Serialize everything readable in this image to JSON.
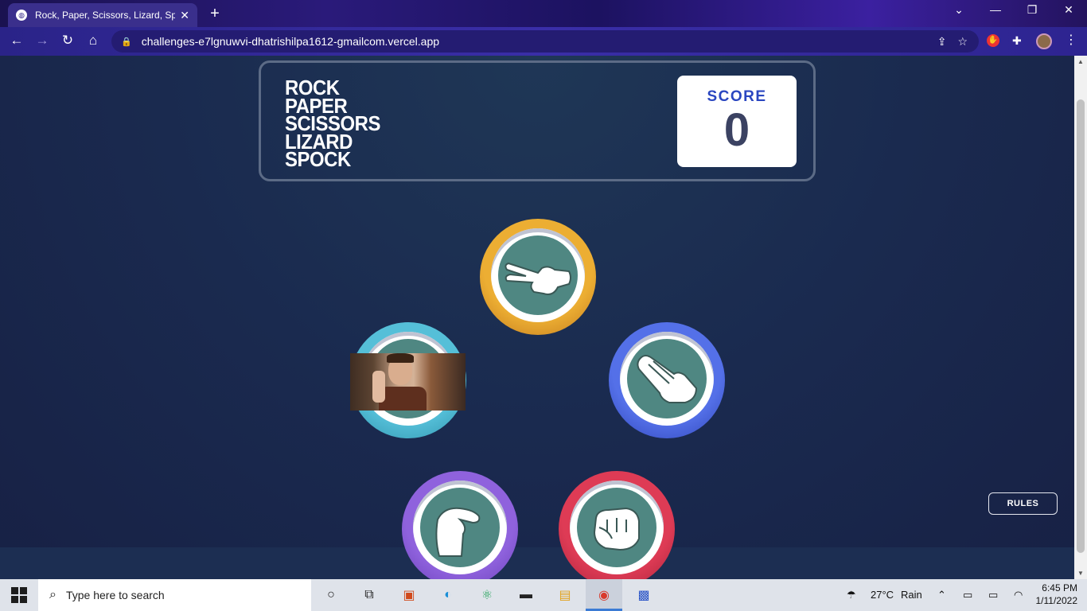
{
  "browser": {
    "tab_title": "Rock, Paper, Scissors, Lizard, Spoc",
    "tab_close": "✕",
    "new_tab": "+",
    "url": "challenges-e7lgnuwvi-dhatrishilpa1612-gmailcom.vercel.app",
    "window_controls": [
      "⌄",
      "—",
      "❐",
      "✕"
    ]
  },
  "game": {
    "title_lines": [
      "ROCK",
      "PAPER",
      "SCISSORS",
      "LIZARD",
      "SPOCK"
    ],
    "score_label": "SCORE",
    "score_value": "0",
    "rules_label": "RULES",
    "choices": [
      {
        "name": "scissors",
        "ring_color": "#e6a52c"
      },
      {
        "name": "paper",
        "ring_color": "#4a63e0"
      },
      {
        "name": "spock",
        "ring_color": "#4ab8d2"
      },
      {
        "name": "lizard",
        "ring_color": "#8a5bd8"
      },
      {
        "name": "rock",
        "ring_color": "#dc3a52"
      }
    ]
  },
  "taskbar": {
    "search_placeholder": "Type here to search",
    "weather_temp": "27°C",
    "weather_text": "Rain",
    "time": "6:45 PM",
    "date": "1/11/2022"
  },
  "colors": {
    "accent": "#2a46c0",
    "score_text": "#3b4262",
    "page_bg": "#1f2b52"
  }
}
